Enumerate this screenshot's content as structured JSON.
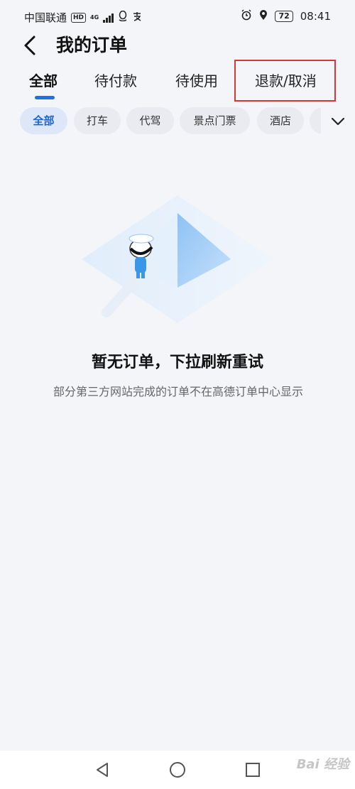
{
  "status_bar": {
    "carrier": "中国联通",
    "hd": "HD",
    "network": "4G",
    "battery": "72",
    "time": "08:41"
  },
  "header": {
    "title": "我的订单"
  },
  "tabs": [
    {
      "label": "全部",
      "active": true
    },
    {
      "label": "待付款",
      "active": false
    },
    {
      "label": "待使用",
      "active": false
    },
    {
      "label": "退款/取消",
      "active": false
    }
  ],
  "chips": [
    {
      "label": "全部",
      "active": true
    },
    {
      "label": "打车",
      "active": false
    },
    {
      "label": "代驾",
      "active": false
    },
    {
      "label": "景点门票",
      "active": false
    },
    {
      "label": "酒店",
      "active": false
    }
  ],
  "empty_state": {
    "title": "暂无订单，下拉刷新重试",
    "description": "部分第三方网站完成的订单不在高德订单中心显示"
  },
  "watermark": "Bai 经验",
  "colors": {
    "accent": "#1f6fe5",
    "background": "#f4f5f9",
    "highlight": "#d83535"
  },
  "icons": {
    "back": "chevron-left-icon",
    "expand": "chevron-down-icon",
    "nav_back": "triangle-back-icon",
    "nav_home": "circle-home-icon",
    "nav_recent": "square-recent-icon"
  }
}
